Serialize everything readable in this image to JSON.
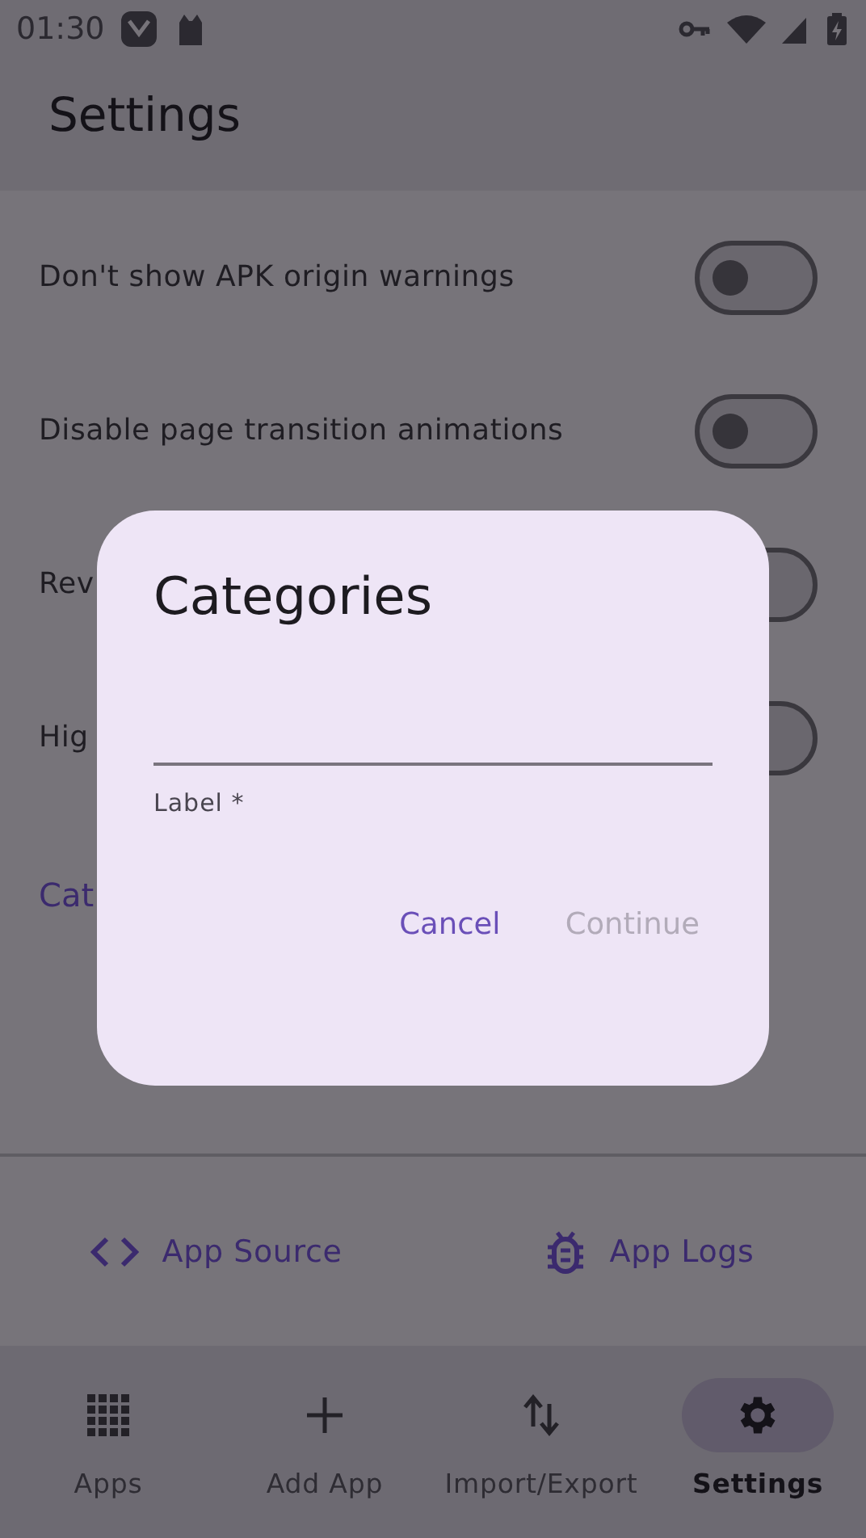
{
  "status_bar": {
    "time": "01:30"
  },
  "app_bar": {
    "title": "Settings"
  },
  "settings": [
    {
      "label": "Don't show APK origin warnings",
      "on": false
    },
    {
      "label": "Disable page transition animations",
      "on": false
    },
    {
      "label": "Rev",
      "on": false
    },
    {
      "label": "Hig",
      "on": false
    }
  ],
  "section_heading": "Cat",
  "links": [
    {
      "label": "App Source"
    },
    {
      "label": "App Logs"
    }
  ],
  "nav": [
    {
      "label": "Apps",
      "selected": false
    },
    {
      "label": "Add App",
      "selected": false
    },
    {
      "label": "Import/Export",
      "selected": false
    },
    {
      "label": "Settings",
      "selected": true
    }
  ],
  "dialog": {
    "title": "Categories",
    "field": {
      "label": "Label *"
    },
    "buttons": [
      {
        "label": "Cancel",
        "disabled": false
      },
      {
        "label": "Continue",
        "disabled": true
      }
    ]
  }
}
